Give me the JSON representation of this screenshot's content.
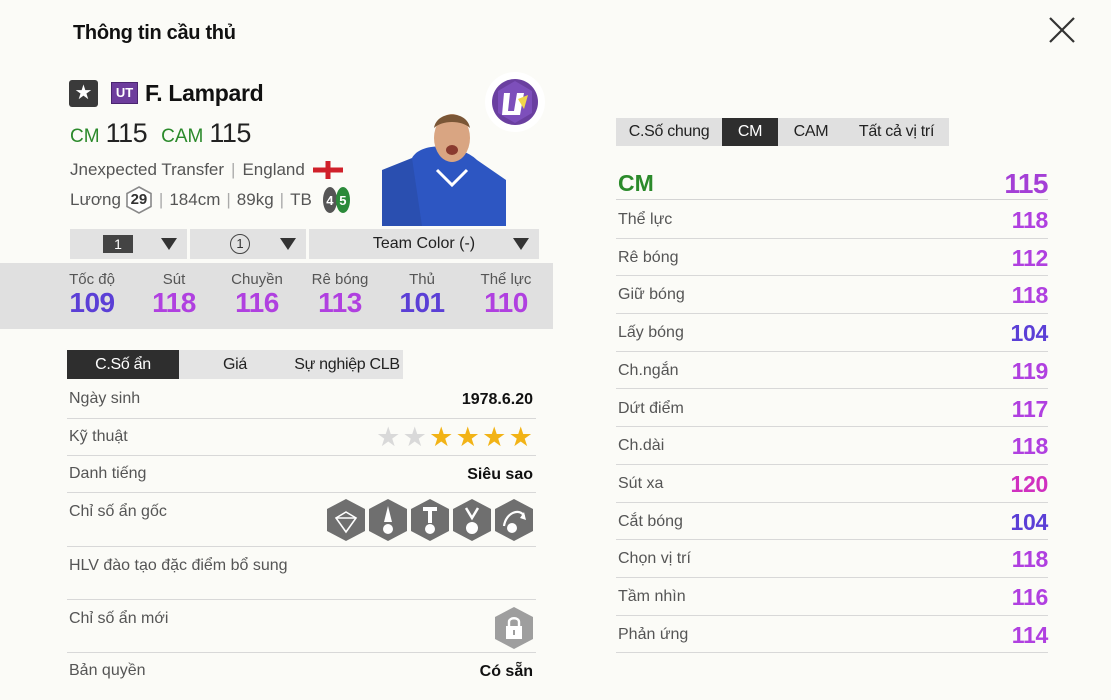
{
  "header": {
    "title": "Thông tin cầu thủ"
  },
  "player": {
    "season_badge": "UT",
    "name": "F. Lampard",
    "positions": [
      {
        "pos": "CM",
        "ovr": "115"
      },
      {
        "pos": "CAM",
        "ovr": "115"
      }
    ],
    "team": "Jnexpected Transfer",
    "nation": "England",
    "salary_label": "Lương",
    "salary": "29",
    "height": "184cm",
    "weight": "89kg",
    "body_type": "TB",
    "weak_foot": "4",
    "strong_foot": "5"
  },
  "dropdowns": {
    "level": "1",
    "rank": "1",
    "team_color": "Team Color (-)"
  },
  "main_stats": [
    {
      "label": "Tốc độ",
      "value": "109",
      "color": "#5b3fd6"
    },
    {
      "label": "Sút",
      "value": "118",
      "color": "#b040e0"
    },
    {
      "label": "Chuyền",
      "value": "116",
      "color": "#b040e0"
    },
    {
      "label": "Rê bóng",
      "value": "113",
      "color": "#b040e0"
    },
    {
      "label": "Thủ",
      "value": "101",
      "color": "#5b3fd6"
    },
    {
      "label": "Thể lực",
      "value": "110",
      "color": "#b040e0"
    }
  ],
  "left_tabs": [
    "C.Số ẩn",
    "Giá",
    "Sự nghiệp CLB"
  ],
  "info": {
    "birth_label": "Ngày sinh",
    "birth_value": "1978.6.20",
    "skill_label": "Kỹ thuật",
    "skill_stars_filled": 4,
    "skill_stars_total": 6,
    "rep_label": "Danh tiếng",
    "rep_value": "Siêu sao",
    "hidden_label": "Chỉ số ẩn gốc",
    "trainer_label": "HLV đào tạo đặc điểm bổ sung",
    "new_hidden_label": "Chỉ số ẩn mới",
    "license_label": "Bản quyền",
    "license_value": "Có sẵn"
  },
  "trait_icons": [
    "diamond-trait-icon",
    "finesse-shot-trait-icon",
    "long-shot-trait-icon",
    "power-header-trait-icon",
    "playmaker-trait-icon"
  ],
  "right_tabs": [
    "C.Số chung",
    "CM",
    "CAM",
    "Tất cả vị trí"
  ],
  "detail": {
    "pos": "CM",
    "ovr": "115",
    "stats": [
      {
        "label": "Thể lực",
        "value": "118",
        "color": "#b040e0"
      },
      {
        "label": "Rê bóng",
        "value": "112",
        "color": "#b040e0"
      },
      {
        "label": "Giữ bóng",
        "value": "118",
        "color": "#b040e0"
      },
      {
        "label": "Lấy bóng",
        "value": "104",
        "color": "#5b3fd6"
      },
      {
        "label": "Ch.ngắn",
        "value": "119",
        "color": "#b040e0"
      },
      {
        "label": "Dứt điểm",
        "value": "117",
        "color": "#b040e0"
      },
      {
        "label": "Ch.dài",
        "value": "118",
        "color": "#b040e0"
      },
      {
        "label": "Sút xa",
        "value": "120",
        "color": "#d030c0"
      },
      {
        "label": "Cắt bóng",
        "value": "104",
        "color": "#5b3fd6"
      },
      {
        "label": "Chọn vị trí",
        "value": "118",
        "color": "#b040e0"
      },
      {
        "label": "Tầm nhìn",
        "value": "116",
        "color": "#b040e0"
      },
      {
        "label": "Phản ứng",
        "value": "114",
        "color": "#b040e0"
      }
    ]
  },
  "colors": {
    "position_green": "#2b8a2b",
    "stat_purple": "#b040e0",
    "stat_indigo": "#5b3fd6",
    "stat_magenta": "#d030c0"
  }
}
